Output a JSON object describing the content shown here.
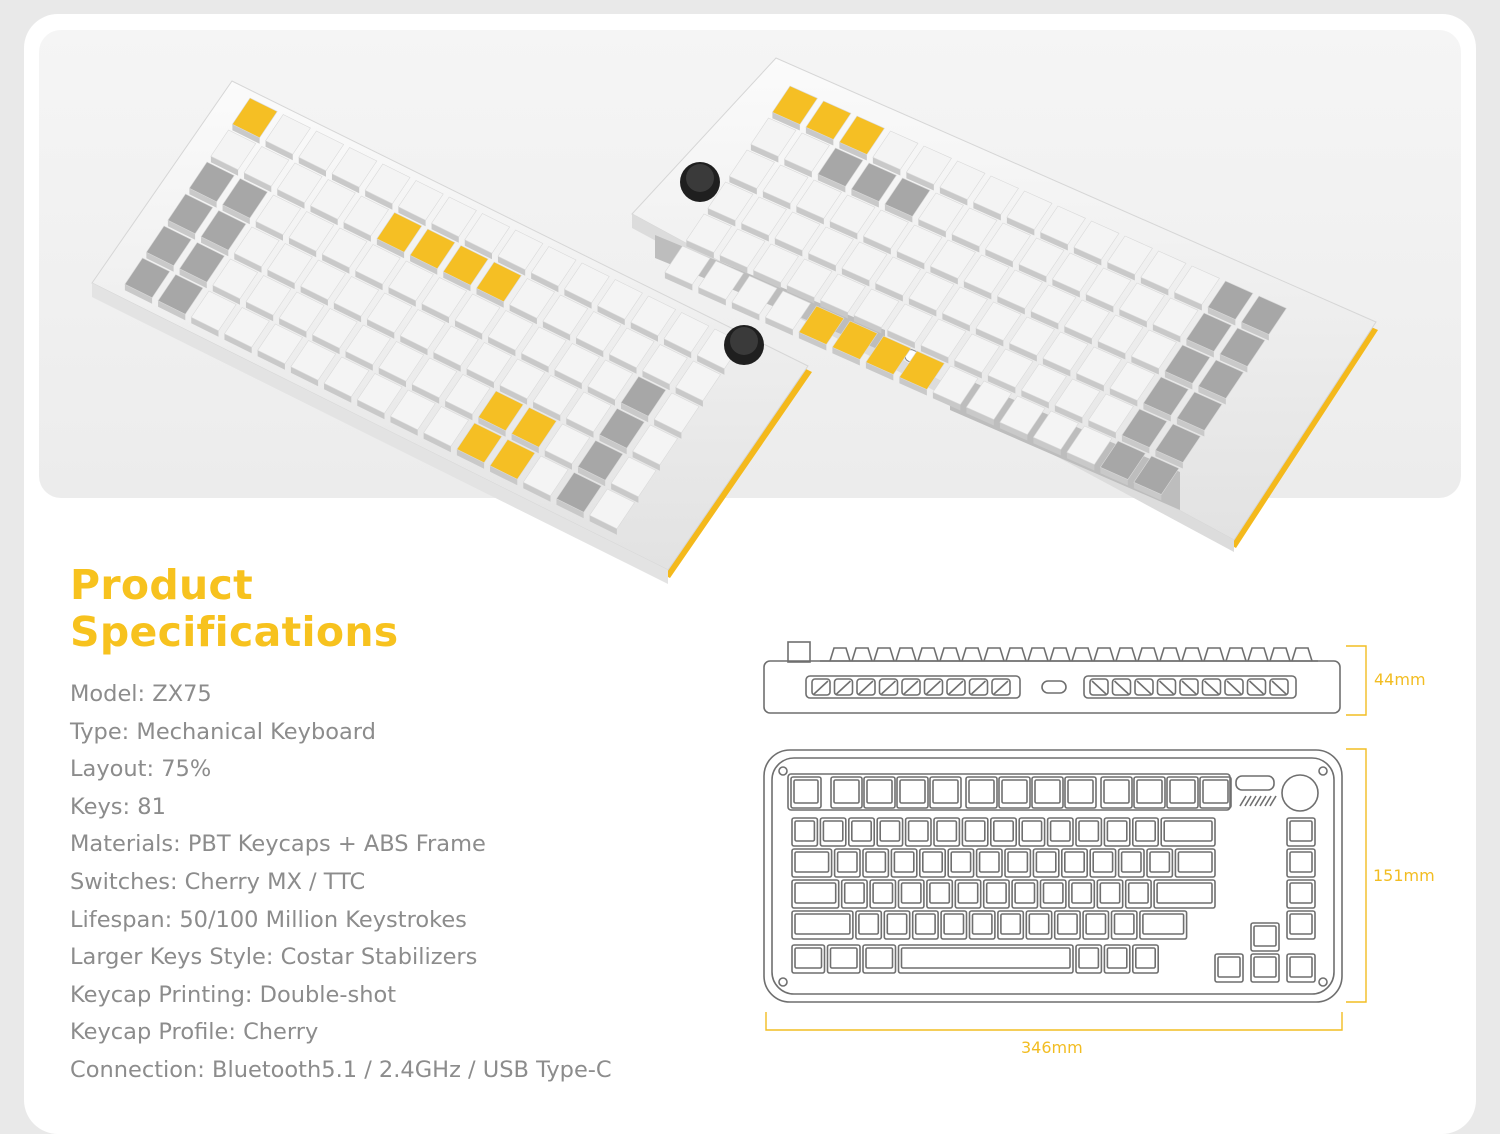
{
  "title": {
    "line1": "Product",
    "line2": "Specifications"
  },
  "specs": [
    {
      "label": "Model",
      "value": "ZX75",
      "text": "Model: ZX75"
    },
    {
      "label": "Type",
      "value": "Mechanical Keyboard",
      "text": "Type: Mechanical Keyboard"
    },
    {
      "label": "Layout",
      "value": "75%",
      "text": "Layout: 75%"
    },
    {
      "label": "Keys",
      "value": "81",
      "text": "Keys: 81"
    },
    {
      "label": "Materials",
      "value": "PBT Keycaps + ABS Frame",
      "text": "Materials: PBT Keycaps + ABS Frame"
    },
    {
      "label": "Switches",
      "value": "Cherry MX  / TTC",
      "text": "Switches: Cherry MX  / TTC"
    },
    {
      "label": "Lifespan",
      "value": "50/100 Million Keystrokes",
      "text": "Lifespan: 50/100 Million Keystrokes"
    },
    {
      "label": "Larger Keys Style",
      "value": "Costar Stabilizers",
      "text": "Larger Keys Style: Costar Stabilizers"
    },
    {
      "label": "Keycap Printing",
      "value": "Double-shot",
      "text": "Keycap Printing: Double-shot"
    },
    {
      "label": "Keycap Profile",
      "value": "Cherry",
      "text": "Keycap Profile: Cherry"
    },
    {
      "label": "Connection",
      "value": "Bluetooth5.1 / 2.4GHz / USB Type-C",
      "text": "Connection: Bluetooth5.1 / 2.4GHz / USB Type-C"
    }
  ],
  "dimensions": {
    "height": "44mm",
    "depth": "151mm",
    "width": "346mm"
  },
  "colors": {
    "accent": "#f7c21e",
    "spec_text": "#8c8c8c",
    "line_art": "#6f6f6f",
    "keycap_white": "#f4f4f4",
    "keycap_gray": "#a7a7a7",
    "keycap_yellow": "#f5bf24"
  }
}
